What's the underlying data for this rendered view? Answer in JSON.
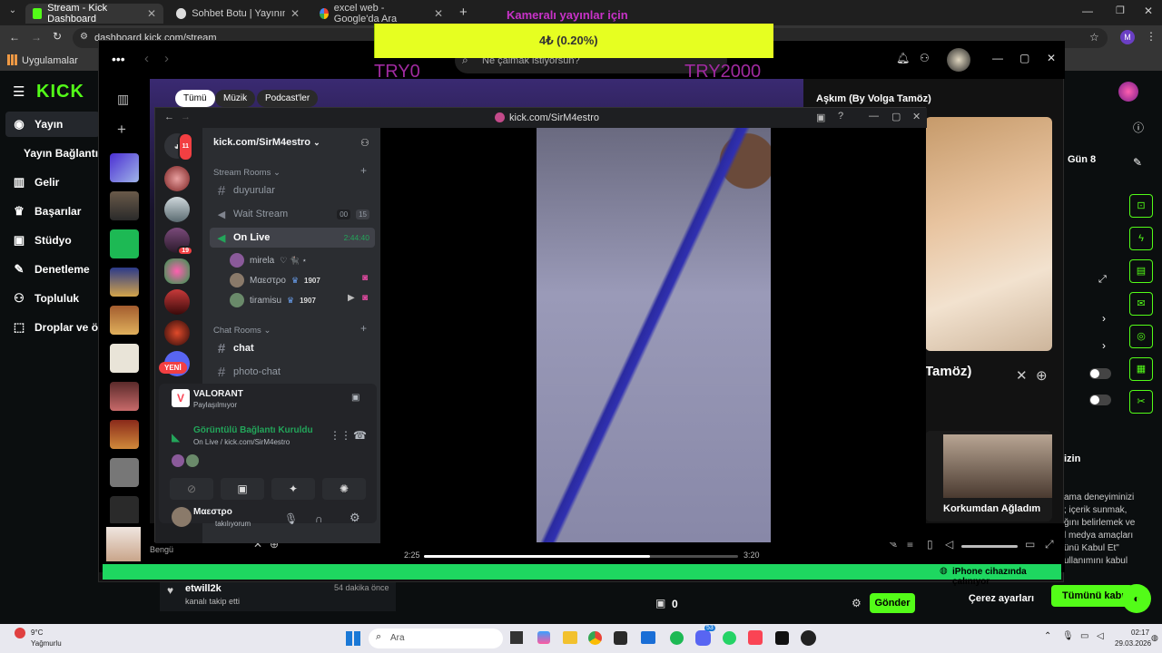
{
  "tabs": [
    {
      "title": "Stream - Kick Dashboard",
      "active": true
    },
    {
      "title": "Sohbet Botu | Yayınını güçlendi",
      "active": false
    },
    {
      "title": "excel web - Google'da Ara",
      "active": false
    }
  ],
  "address": "dashboard.kick.com/stream",
  "bookmarks": {
    "apps_label": "Uygulamalar"
  },
  "overlay": {
    "caption": "Kameralı yayınlar için",
    "progress_text": "4₺ (0.20%)",
    "goal_left": "TRY0",
    "goal_right": "TRY2000",
    "progress_fraction": 0.002
  },
  "kick": {
    "logo": "KICK",
    "nav": [
      {
        "label": "Yayın",
        "icon": "broadcast-icon"
      },
      {
        "label": "Yayın Bağlantısı",
        "icon": ""
      },
      {
        "label": "Gelir",
        "icon": "chart-icon"
      },
      {
        "label": "Başarılar",
        "icon": "trophy-icon"
      },
      {
        "label": "Stüdyo",
        "icon": "studio-icon"
      },
      {
        "label": "Denetleme",
        "icon": "wrench-icon"
      },
      {
        "label": "Topluluk",
        "icon": "people-icon"
      },
      {
        "label": "Droplar ve ödü",
        "icon": "drops-icon"
      }
    ],
    "right_labels": {
      "day": "Gün 8",
      "izin": "izin"
    },
    "cookie_text": [
      "ama deneyiminizi",
      "; içerik sunmak,",
      "ğını belirlemek ve",
      "l medya amaçları",
      "ünü Kabul Et\"",
      "ullanımını kabul"
    ],
    "cookie_settings": "Çerez ayarları",
    "accept_all": "Tümünü kabul",
    "activity": {
      "user": "etwill2k",
      "time": "54 dakika önce",
      "text": "kanalı takip etti"
    },
    "chat": {
      "count": "0",
      "send": "Gönder"
    }
  },
  "spotify": {
    "search_placeholder": "Ne çalmak istiyorsun?",
    "chips": [
      "Tümü",
      "Müzik",
      "Podcast'ler"
    ],
    "np_title": "Aşkım (By Volga Tamöz)",
    "np_title_partial": "Tamöz)",
    "related_title": "Korkumdan Ağladım",
    "player": {
      "artist": "Bengü",
      "elapsed": "2:25",
      "total": "3:20",
      "progress_fraction": 0.72
    },
    "device_bar": "iPhone cihazında çalınıyor"
  },
  "discord": {
    "title": "kick.com/SirM4estro",
    "server_name": "kick.com/SirM4estro",
    "categories": {
      "stream": "Stream Rooms",
      "chat": "Chat Rooms"
    },
    "channels": {
      "duyurular": "duyurular",
      "wait": {
        "name": "Wait Stream",
        "a": "00",
        "b": "15"
      },
      "live": {
        "name": "On Live",
        "time": "2:44:40"
      },
      "chat": "chat",
      "photo": "photo-chat"
    },
    "members": [
      {
        "name": "mirela",
        "extra": "♡ 🐈‍⬛ ⋆"
      },
      {
        "name": "Mαεστρο",
        "level": "1907"
      },
      {
        "name": "tiramisu",
        "level": "1907"
      }
    ],
    "badges": {
      "dm": "11",
      "s1": "19"
    },
    "new_pill": "YENİ",
    "activity": {
      "game": "VALORANT",
      "sub": "Paylaşılmıyor"
    },
    "voice": {
      "status": "Görüntülü Bağlantı Kuruldu",
      "channel": "On Live / kick.com/SirM4estro"
    },
    "user": {
      "name": "Mαεστρο",
      "status": "takılıyorum"
    }
  },
  "taskbar": {
    "weather_temp": "9°C",
    "weather_text": "Yağmurlu",
    "search": "Ara",
    "discord_badge": "53",
    "time": "02:17",
    "date": "29.03.2026"
  }
}
